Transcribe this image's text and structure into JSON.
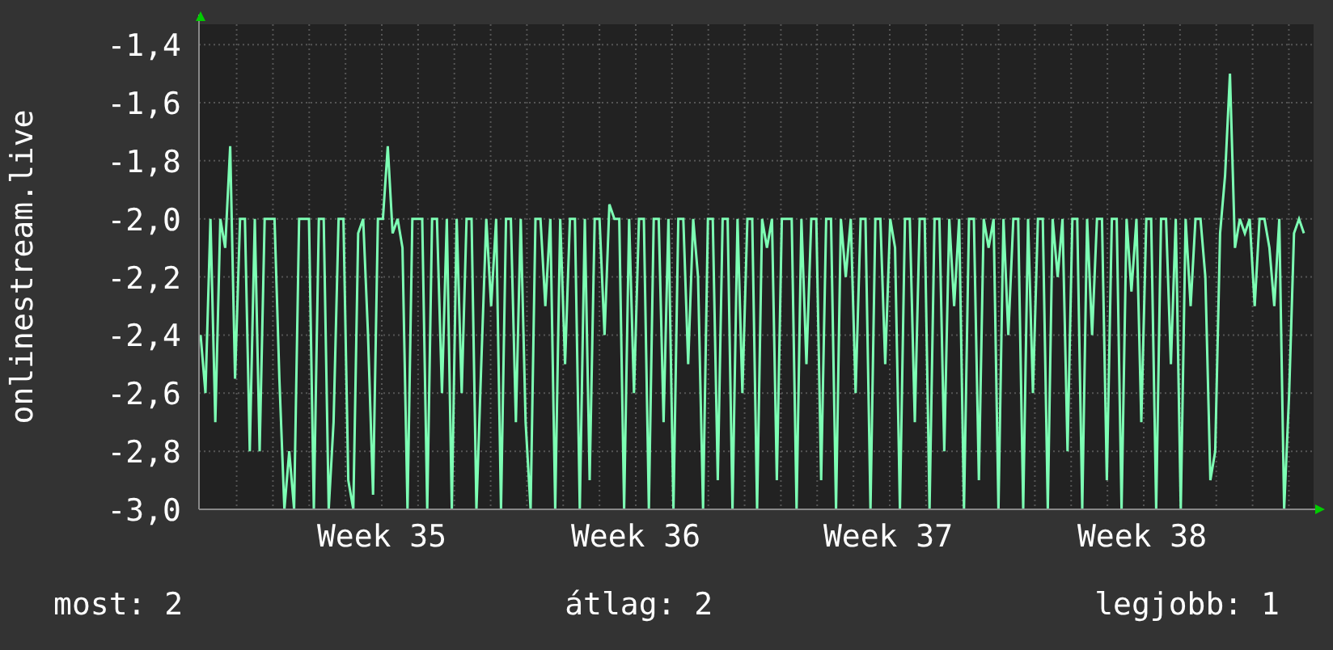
{
  "graph": {
    "chart_data": {
      "type": "line",
      "ylabel": "onlinestream.live",
      "ylim": [
        -3.0,
        -1.33
      ],
      "yticks": [
        {
          "value": -1.4,
          "label": "-1,4"
        },
        {
          "value": -1.6,
          "label": "-1,6"
        },
        {
          "value": -1.8,
          "label": "-1,8"
        },
        {
          "value": -2.0,
          "label": "-2,0"
        },
        {
          "value": -2.2,
          "label": "-2,2"
        },
        {
          "value": -2.4,
          "label": "-2,4"
        },
        {
          "value": -2.6,
          "label": "-2,6"
        },
        {
          "value": -2.8,
          "label": "-2,8"
        },
        {
          "value": -3.0,
          "label": "-3,0"
        }
      ],
      "grid": true,
      "series": [
        {
          "color": "#7dffb4",
          "values": [
            -2.4,
            -2.6,
            -2,
            -2.7,
            -2,
            -2.1,
            -1.75,
            -2.55,
            -2,
            -2,
            -2.8,
            -2,
            -2.8,
            -2,
            -2,
            -2,
            -2.55,
            -3,
            -2.8,
            -3,
            -2,
            -2,
            -2,
            -3,
            -2,
            -2,
            -3,
            -2.7,
            -2,
            -2,
            -2.9,
            -3,
            -2.05,
            -2,
            -2.4,
            -2.95,
            -2,
            -2,
            -1.75,
            -2.05,
            -2,
            -2.1,
            -3,
            -2,
            -2,
            -2,
            -3,
            -2,
            -2,
            -2.6,
            -2,
            -3,
            -2,
            -2.6,
            -2,
            -2,
            -3,
            -2.5,
            -2,
            -2.3,
            -2,
            -3,
            -2,
            -2,
            -2.7,
            -2,
            -2.7,
            -3,
            -2,
            -2,
            -2.3,
            -2,
            -3,
            -2,
            -2.5,
            -2,
            -2,
            -3,
            -2,
            -2.9,
            -2,
            -2,
            -2.4,
            -1.95,
            -2,
            -2,
            -3,
            -2,
            -2.6,
            -2,
            -2,
            -3,
            -2,
            -2,
            -2.7,
            -2,
            -3,
            -2,
            -2,
            -2.5,
            -2,
            -2.2,
            -3,
            -2,
            -2,
            -2.9,
            -2,
            -2,
            -3,
            -2,
            -2.6,
            -2,
            -2,
            -3,
            -2,
            -2.1,
            -2,
            -2.9,
            -2,
            -2,
            -2,
            -3,
            -2,
            -2.5,
            -2,
            -2,
            -2.9,
            -2,
            -2,
            -3,
            -2,
            -2.2,
            -2,
            -2.6,
            -2,
            -2,
            -3,
            -2,
            -2,
            -2.5,
            -2,
            -2.1,
            -3,
            -2,
            -2,
            -2.7,
            -2,
            -2,
            -3,
            -2,
            -2,
            -2.8,
            -2,
            -2.3,
            -2,
            -3,
            -2,
            -2,
            -2.9,
            -2,
            -2.1,
            -2,
            -3,
            -2,
            -2.4,
            -2,
            -2,
            -3,
            -2,
            -2.6,
            -2,
            -2,
            -3,
            -2,
            -2.2,
            -2,
            -2.8,
            -2,
            -2,
            -3,
            -2,
            -2.4,
            -2,
            -2,
            -2.9,
            -2,
            -2,
            -3,
            -2,
            -2.25,
            -2,
            -2.7,
            -2,
            -2,
            -3,
            -2,
            -2,
            -2.5,
            -2,
            -3,
            -2,
            -2.3,
            -2,
            -2,
            -2.2,
            -2.9,
            -2.8,
            -2.05,
            -1.85,
            -1.5,
            -2.1,
            -2,
            -2.05,
            -2,
            -2.3,
            -2,
            -2,
            -2.1,
            -2.3,
            -2,
            -3,
            -2.6,
            -2.05,
            -2,
            -2.05
          ]
        }
      ]
    }
  },
  "x_labels": [
    "Week 35",
    "Week 36",
    "Week 37",
    "Week 38"
  ],
  "legend": [
    "most: 2",
    "átlag: 2",
    "legjobb: 1"
  ]
}
